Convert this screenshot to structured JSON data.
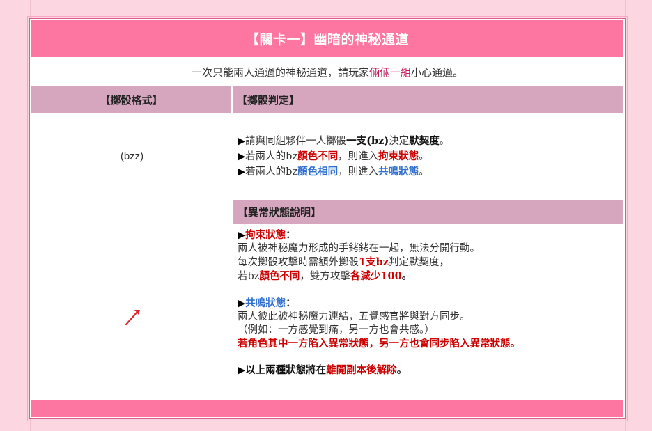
{
  "title": "【關卡一】幽暗的神秘通道",
  "intro": {
    "prefix": "一次只能兩人通過的神秘通道，請玩家",
    "highlight": "倆倆一組",
    "suffix": "小心通過。"
  },
  "headers": {
    "left": "【擲骰格式】",
    "right": "【擲骰判定】"
  },
  "format_text": "(bzz)",
  "judge": {
    "line1": {
      "tri": "▶",
      "a": "請與同組夥伴一人擲骰",
      "b": "一支(bz)",
      "c": "決定",
      "d": "默契度",
      "e": "。"
    },
    "line2": {
      "tri": "▶",
      "a": "若兩人的bz",
      "b": "顏色不同",
      "c": "，則進入",
      "d": "拘束狀態",
      "e": "。"
    },
    "line3": {
      "tri": "▶",
      "a": "若兩人的bz",
      "b": "顏色相同",
      "c": "，則進入",
      "d": "共鳴狀態",
      "e": "。"
    }
  },
  "status_header": "【異常狀態說明】",
  "bind_state": {
    "tri": "▶",
    "name": "拘束狀態",
    "colon": "：",
    "desc1": "兩人被神秘魔力形成的手銬銬在一起，無法分開行動。",
    "desc2_a": "每次擲骰攻擊時需額外擲骰",
    "desc2_b": "1支bz",
    "desc2_c": "判定默契度，",
    "desc3_a": "若bz",
    "desc3_b": "顏色不同",
    "desc3_c": "，雙方攻擊",
    "desc3_d": "各減少100",
    "desc3_e": "。"
  },
  "resonance_state": {
    "tri": "▶",
    "name": "共鳴狀態",
    "colon": "：",
    "desc1": "兩人彼此被神秘魔力連結，五覺感官將與對方同步。",
    "desc2": "（例如：一方感覺到痛，另一方也會共感。）",
    "desc3": "若角色其中一方陷入異常狀態，另一方也會同步陷入異常狀態。"
  },
  "release": {
    "tri": "▶",
    "a": "以上兩種狀態將在",
    "b": "離開副本後解除",
    "c": "。"
  },
  "colors": {
    "page_bg": "#fcd7e2",
    "title_bar": "#fd75a1",
    "section_header": "#d5a6bd",
    "red_text": "#cc0000",
    "blue_text": "#2f6fd0",
    "intro_highlight": "#c2185b"
  },
  "icons": {
    "pin": "pushpin-icon"
  }
}
